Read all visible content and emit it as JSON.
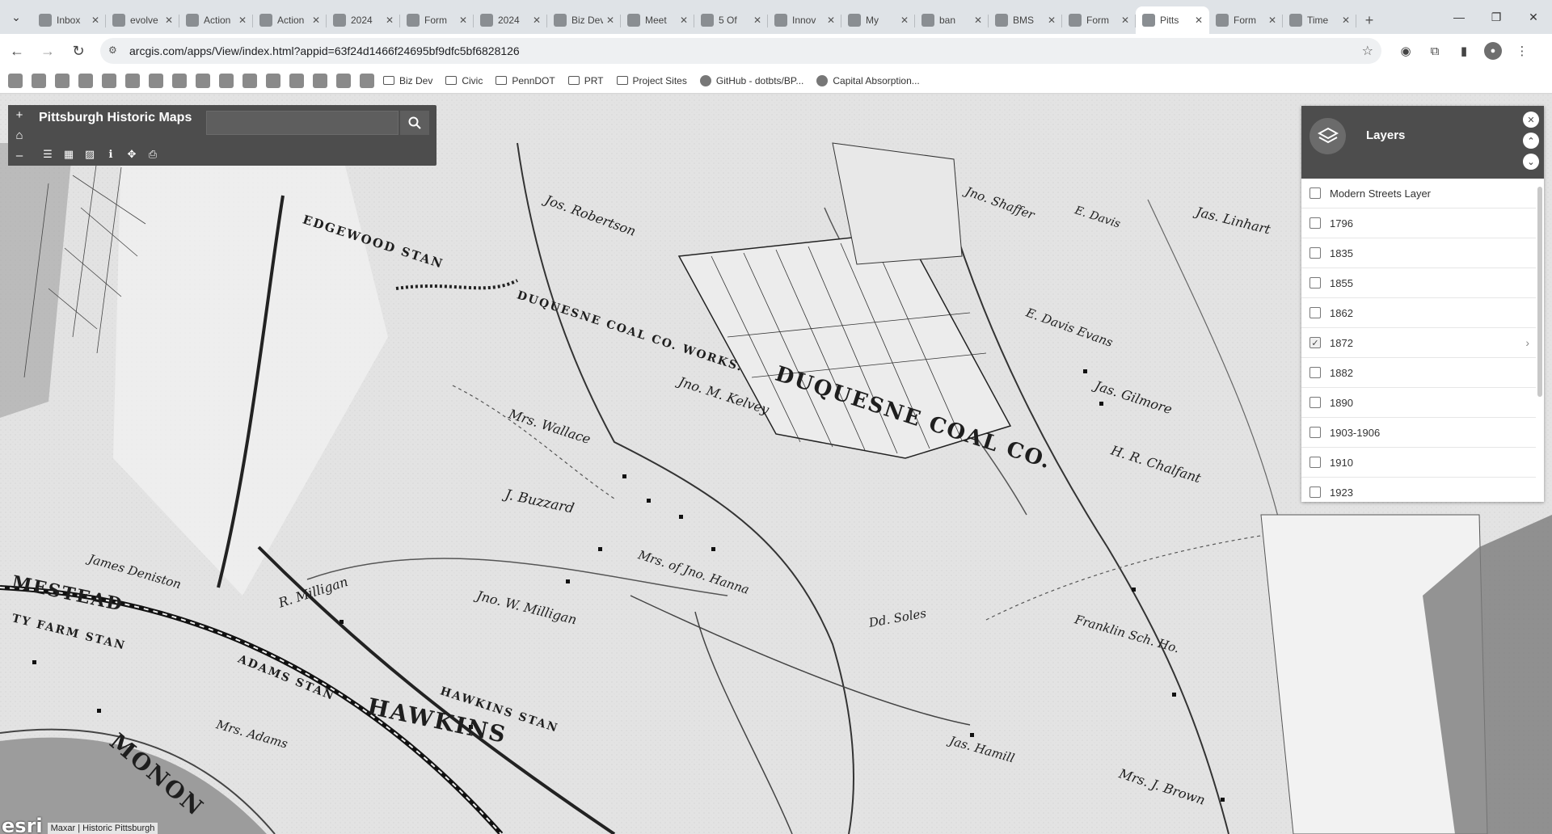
{
  "tabs": [
    {
      "title": "Inbox",
      "icon": "gmail-icon"
    },
    {
      "title": "evolve",
      "icon": "doc-icon"
    },
    {
      "title": "Action",
      "icon": "drive-icon"
    },
    {
      "title": "Action",
      "icon": "pdf-icon"
    },
    {
      "title": "2024",
      "icon": "page-icon"
    },
    {
      "title": "Form",
      "icon": "form-icon"
    },
    {
      "title": "2024",
      "icon": "globe-icon"
    },
    {
      "title": "Biz Dev",
      "icon": "w-icon"
    },
    {
      "title": "Meet",
      "icon": "w-icon"
    },
    {
      "title": "5 Of",
      "icon": "w-icon"
    },
    {
      "title": "Innov",
      "icon": "globe-icon"
    },
    {
      "title": "My",
      "icon": "drive-icon"
    },
    {
      "title": "ban",
      "icon": "doc-icon"
    },
    {
      "title": "BMS",
      "icon": "w-icon"
    },
    {
      "title": "Form",
      "icon": "flag-icon"
    },
    {
      "title": "Pitts",
      "icon": "globe-icon",
      "active": true
    },
    {
      "title": "Form",
      "icon": "question-icon"
    },
    {
      "title": "Time",
      "icon": "n-icon"
    }
  ],
  "address": {
    "url": "arcgis.com/apps/View/index.html?appid=63f24d1466f24695bf9dfc5bf6828126"
  },
  "bookmarks": {
    "folders": [
      "Biz Dev",
      "Civic",
      "PennDOT",
      "PRT",
      "Project Sites"
    ],
    "links": [
      "GitHub - dotbts/BP...",
      "Capital Absorption..."
    ]
  },
  "app": {
    "title": "Pittsburgh Historic Maps",
    "search_placeholder": ""
  },
  "layers_panel": {
    "title": "Layers",
    "items": [
      {
        "label": "Modern Streets Layer",
        "checked": false
      },
      {
        "label": "1796",
        "checked": false
      },
      {
        "label": "1835",
        "checked": false
      },
      {
        "label": "1855",
        "checked": false
      },
      {
        "label": "1862",
        "checked": false
      },
      {
        "label": "1872",
        "checked": true
      },
      {
        "label": "1882",
        "checked": false
      },
      {
        "label": "1890",
        "checked": false
      },
      {
        "label": "1903-1906",
        "checked": false
      },
      {
        "label": "1910",
        "checked": false
      },
      {
        "label": "1923",
        "checked": false
      }
    ]
  },
  "map_labels": {
    "duquesne_coal": "DUQUESNE COAL CO.",
    "duquesne_works": "DUQUESNE COAL CO. WORKS.",
    "hawkins": "HAWKINS",
    "hawkins_stan": "HAWKINS STAN",
    "edgewood": "EDGEWOOD STAN",
    "mestead": "MESTEAD",
    "adams_stan": "ADAMS STAN",
    "farm_stan": "TY FARM STAN",
    "monon": "MONON",
    "buzzard": "J. Buzzard",
    "wallace": "Mrs. Wallace",
    "robertson": "Jos. Robertson",
    "kelvey": "Jno. M. Kelvey",
    "milligan": "R. Milligan",
    "jno_milligan": "Jno. W. Milligan",
    "hanna": "Mrs. of Jno. Hanna",
    "denniston": "James Deniston",
    "gilmore": "Jas. Gilmore",
    "chalfant": "H. R. Chalfant",
    "shaffer": "Jno. Shaffer",
    "davis": "E. Davis",
    "evans": "E. Davis Evans",
    "dd_soles": "Dd. Soles",
    "hamill": "Jas. Hamill",
    "j_brown": "Mrs. J. Brown",
    "franklin": "Franklin Sch. Ho.",
    "adams": "Mrs. Adams",
    "linhart": "Jas. Linhart"
  },
  "attribution": {
    "logo": "esri",
    "credit": "Maxar | Historic Pittsburgh"
  }
}
